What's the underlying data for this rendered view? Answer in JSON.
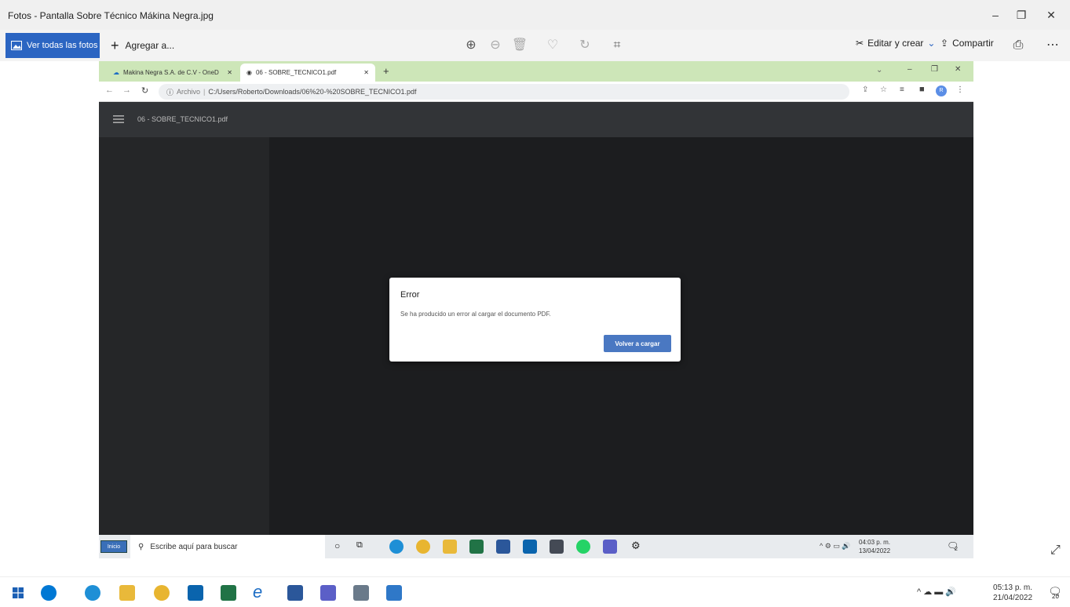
{
  "photos_app": {
    "title": "Fotos - Pantalla Sobre Técnico Mákina Negra.jpg",
    "toolbar": {
      "all_photos_label": "Ver todas las fotos",
      "add_to_label": "Agregar a...",
      "edit_create_label": "Editar y crear",
      "share_label": "Compartir"
    }
  },
  "browser": {
    "tabs": [
      {
        "label": "Makina Negra S.A. de C.V - OneD"
      },
      {
        "label": "06 - SOBRE_TECNICO1.pdf"
      }
    ],
    "url_prefix": "Archivo",
    "url": "C:/Users/Roberto/Downloads/06%20-%20SOBRE_TECNICO1.pdf",
    "profile_initial": "R"
  },
  "pdf_viewer": {
    "file_title": "06 - SOBRE_TECNICO1.pdf",
    "dialog": {
      "title": "Error",
      "message": "Se ha producido un error al cargar el documento PDF.",
      "button": "Volver a cargar"
    }
  },
  "inner_taskbar": {
    "start_label": "Inicio",
    "search_placeholder": "Escribe aquí para buscar",
    "time": "04:03 p. m.",
    "date": "13/04/2022",
    "notification_count": "2"
  },
  "taskbar": {
    "time": "05:13 p. m.",
    "date": "21/04/2022",
    "notification_count": "20"
  },
  "colors": {
    "accent": "#2b65c2",
    "tabbar": "#cde6b8",
    "pdf_bg": "#1c1d1f",
    "reload_button": "#4a78c2"
  }
}
